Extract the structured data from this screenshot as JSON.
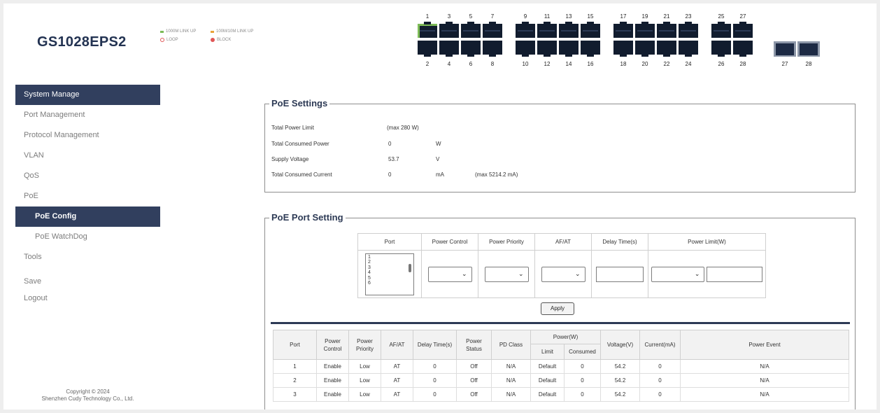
{
  "header": {
    "model": "GS1028EPS2",
    "legend": {
      "link_1000": "1000M LINK UP",
      "link_100": "100M/10M LINK UP",
      "loop": "LOOP",
      "block": "BLOCK"
    },
    "top_ports": [
      "1",
      "3",
      "5",
      "7",
      "9",
      "11",
      "13",
      "15",
      "17",
      "19",
      "21",
      "23",
      "25",
      "27"
    ],
    "bottom_ports": [
      "2",
      "4",
      "6",
      "8",
      "10",
      "12",
      "14",
      "16",
      "18",
      "20",
      "22",
      "24",
      "26",
      "28"
    ],
    "sfp_ports": [
      "27",
      "28"
    ],
    "colors": {
      "link_1000": "#7dbb57",
      "link_100": "#e8a33b",
      "alert": "#e05656",
      "port": "#111c2e"
    }
  },
  "sidebar": {
    "items": [
      {
        "label": "System Manage",
        "active": true
      },
      {
        "label": "Port Management"
      },
      {
        "label": "Protocol Management"
      },
      {
        "label": "VLAN"
      },
      {
        "label": "QoS"
      },
      {
        "label": "PoE"
      },
      {
        "label": "PoE Config",
        "active": true,
        "sub": true
      },
      {
        "label": "PoE WatchDog",
        "sub": true
      },
      {
        "label": "Tools"
      },
      {
        "label": "Save"
      },
      {
        "label": "Logout"
      }
    ],
    "copyright_line1": "Copyright © 2024",
    "copyright_line2": "Shenzhen Cudy Technology Co., Ltd."
  },
  "poe_settings": {
    "title": "PoE Settings",
    "total_power_limit": {
      "label": "Total Power Limit",
      "value": "",
      "unit": "(max 280 W)"
    },
    "total_consumed_power": {
      "label": "Total Consumed Power",
      "value": "0",
      "unit": "W"
    },
    "supply_voltage": {
      "label": "Supply Voltage",
      "value": "53.7",
      "unit": "V"
    },
    "total_consumed_current": {
      "label": "Total Consumed Current",
      "value": "0",
      "unit": "mA",
      "note": "(max 5214.2 mA)"
    }
  },
  "poe_port_setting": {
    "title": "PoE Port Setting",
    "columns": [
      "Port",
      "Power Control",
      "Power Priority",
      "AF/AT",
      "Delay Time(s)",
      "Power Limit(W)"
    ],
    "port_list": [
      "1",
      "2",
      "3",
      "4",
      "5",
      "6"
    ],
    "apply_label": "Apply"
  },
  "port_table": {
    "headers": {
      "port": "Port",
      "power_control": "Power Control",
      "power_priority": "Power Priority",
      "afat": "AF/AT",
      "delay": "Delay Time(s)",
      "power_status": "Power Status",
      "pd_class": "PD Class",
      "power_w": "Power(W)",
      "limit": "Limit",
      "consumed": "Consumed",
      "voltage": "Voltage(V)",
      "current": "Current(mA)",
      "event": "Power Event"
    },
    "rows": [
      [
        "1",
        "Enable",
        "Low",
        "AT",
        "0",
        "Off",
        "N/A",
        "Default",
        "0",
        "54.2",
        "0",
        "N/A"
      ],
      [
        "2",
        "Enable",
        "Low",
        "AT",
        "0",
        "Off",
        "N/A",
        "Default",
        "0",
        "54.2",
        "0",
        "N/A"
      ],
      [
        "3",
        "Enable",
        "Low",
        "AT",
        "0",
        "Off",
        "N/A",
        "Default",
        "0",
        "54.2",
        "0",
        "N/A"
      ]
    ]
  }
}
